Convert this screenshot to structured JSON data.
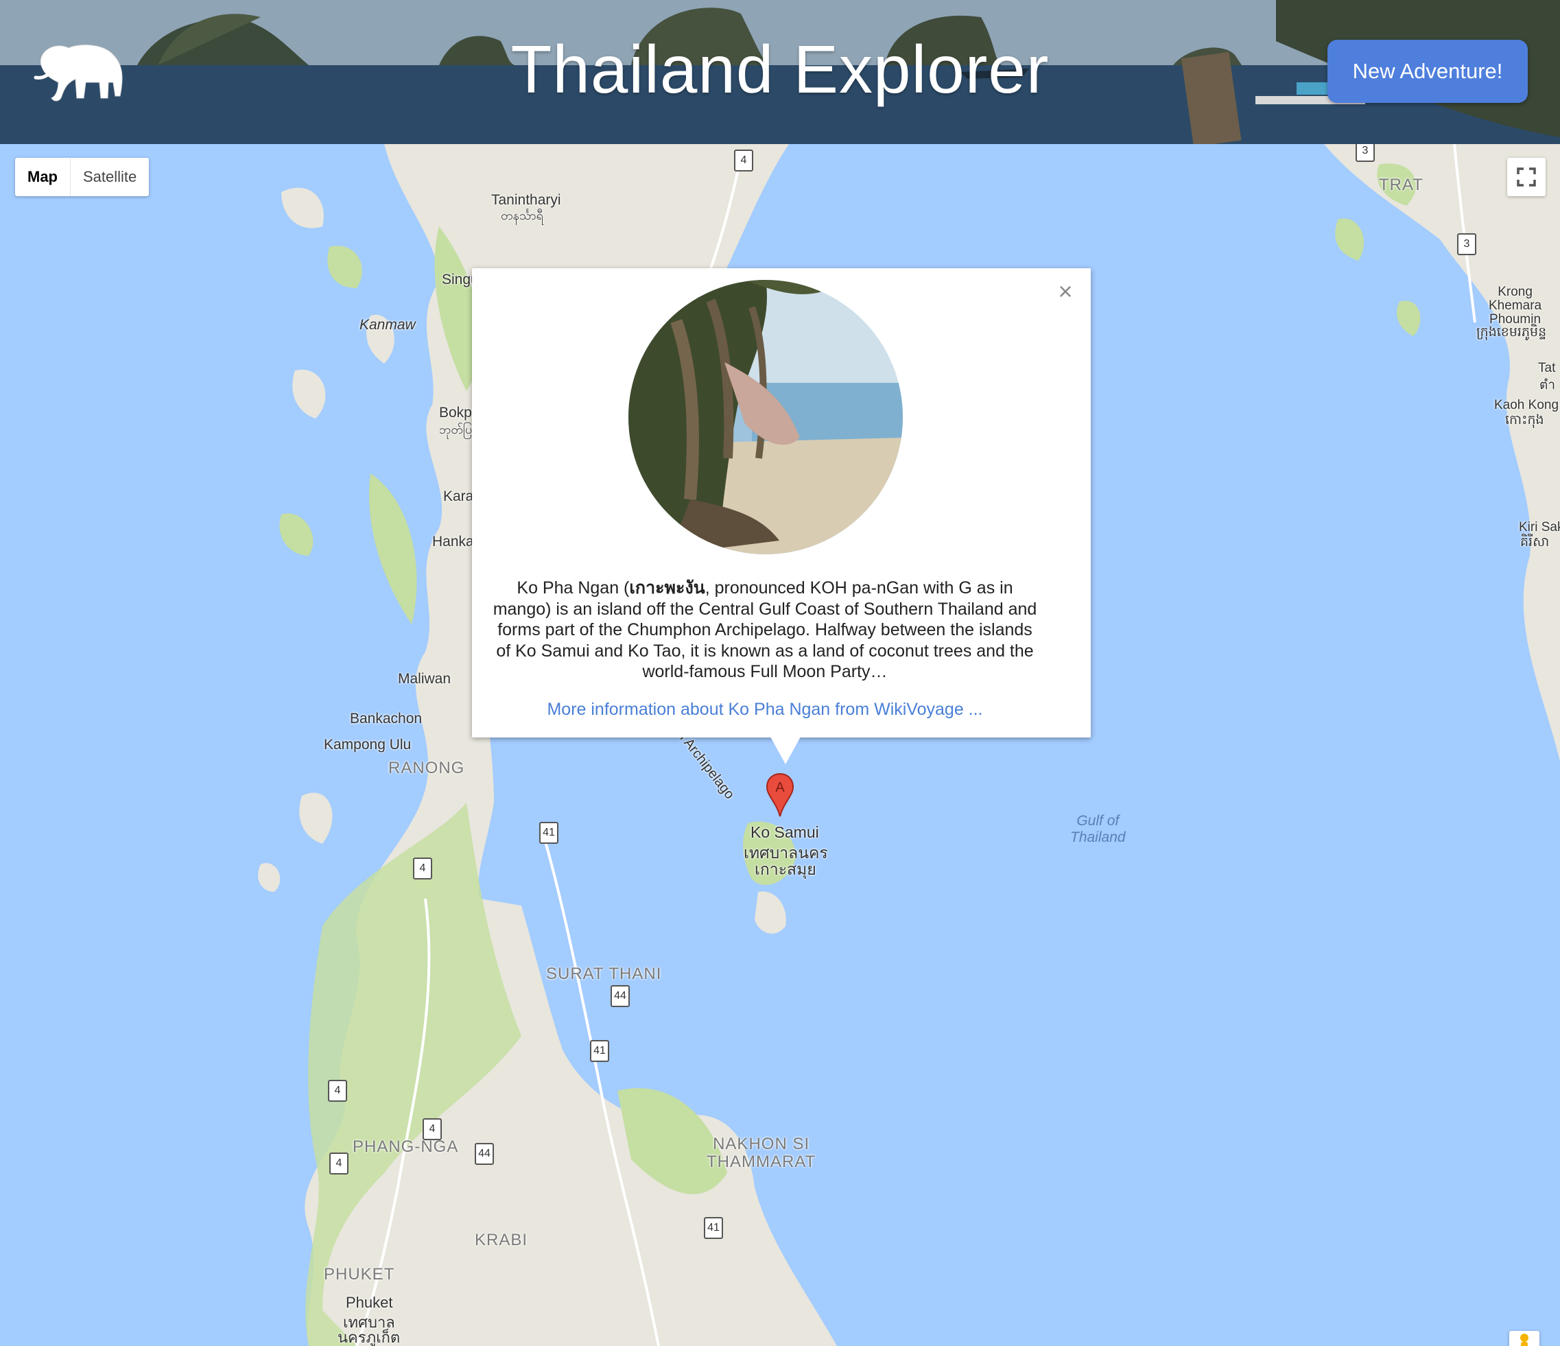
{
  "header": {
    "title": "Thailand Explorer",
    "logo": "elephant-icon",
    "new_adventure_label": "New Adventure!"
  },
  "map": {
    "type_controls": {
      "map_label": "Map",
      "satellite_label": "Satellite",
      "active": "Map"
    },
    "fullscreen_icon": "fullscreen-icon",
    "pegman_icon": "pegman-icon",
    "marker": {
      "label": "A",
      "color": "#e94b3c"
    },
    "labels": {
      "tanintharyi": "Tanintharyi",
      "tanintharyi_burmese": "တနင်္သာရီ",
      "kanmaw": "Kanmaw",
      "singu": "Singu",
      "bokpyin": "Bokp",
      "bokpyin_burmese": "ဘုတ်ပြ",
      "karathuri": "Kara",
      "hanka": "Hanka",
      "maliwan": "Maliwan",
      "bankachon": "Bankachon",
      "kampong_ulu": "Kampong Ulu",
      "ranong": "RANONG",
      "ko_samui": "Ko Samui",
      "ko_samui_thai_1": "เทศบาลนคร",
      "ko_samui_thai_2": "เกาะสมุย",
      "archipelago": "n Archipelago",
      "gulf": "Gulf of\nThailand",
      "surat_thani": "SURAT THANI",
      "phang_nga": "PHANG-NGA",
      "nakhon_si_thammarat": "NAKHON SI\nTHAMMARAT",
      "krabi": "KRABI",
      "phuket_region": "PHUKET",
      "phuket": "Phuket",
      "phuket_thai_1": "เทศบาล",
      "phuket_thai_2": "นครภูเก็ต",
      "trat": "TRAT",
      "krong_khemara": "Krong\nKhemara\nPhoumin",
      "krong_khemara_khmer": "ក្រុងខេមរភូមិន្ទ",
      "tat": "Tat",
      "tat_thai": "ตำ",
      "kaoh_kong": "Kaoh Kong",
      "kaoh_kong_khmer": "កោះកុង",
      "kiri_sakor": "Kiri Sak",
      "kiri_sakor_khmer": "គិរីសា"
    },
    "road_shields": [
      "4",
      "3",
      "3",
      "41",
      "4",
      "44",
      "41",
      "4",
      "4",
      "44",
      "4",
      "41"
    ]
  },
  "popup": {
    "close_icon": "close-icon",
    "photo": "beach-hammock-photo",
    "description_bold": "เกาะพะงัน",
    "description_pre": "Ko Pha Ngan (",
    "description_post": ", pronounced KOH pa-nGan with G as in mango) is an island off the Central Gulf Coast of Southern Thailand and forms part of the Chumphon Archipelago. Halfway between the islands of Ko Samui and Ko Tao, it is known as a land of coconut trees and the world-famous Full Moon Party…",
    "more_link": "More information about Ko Pha Ngan from WikiVoyage ..."
  },
  "colors": {
    "water": "#a3ccff",
    "land": "#e8e6dd",
    "forest": "#c5dea2",
    "button": "#4f7fdc",
    "link": "#4a7fd6"
  }
}
